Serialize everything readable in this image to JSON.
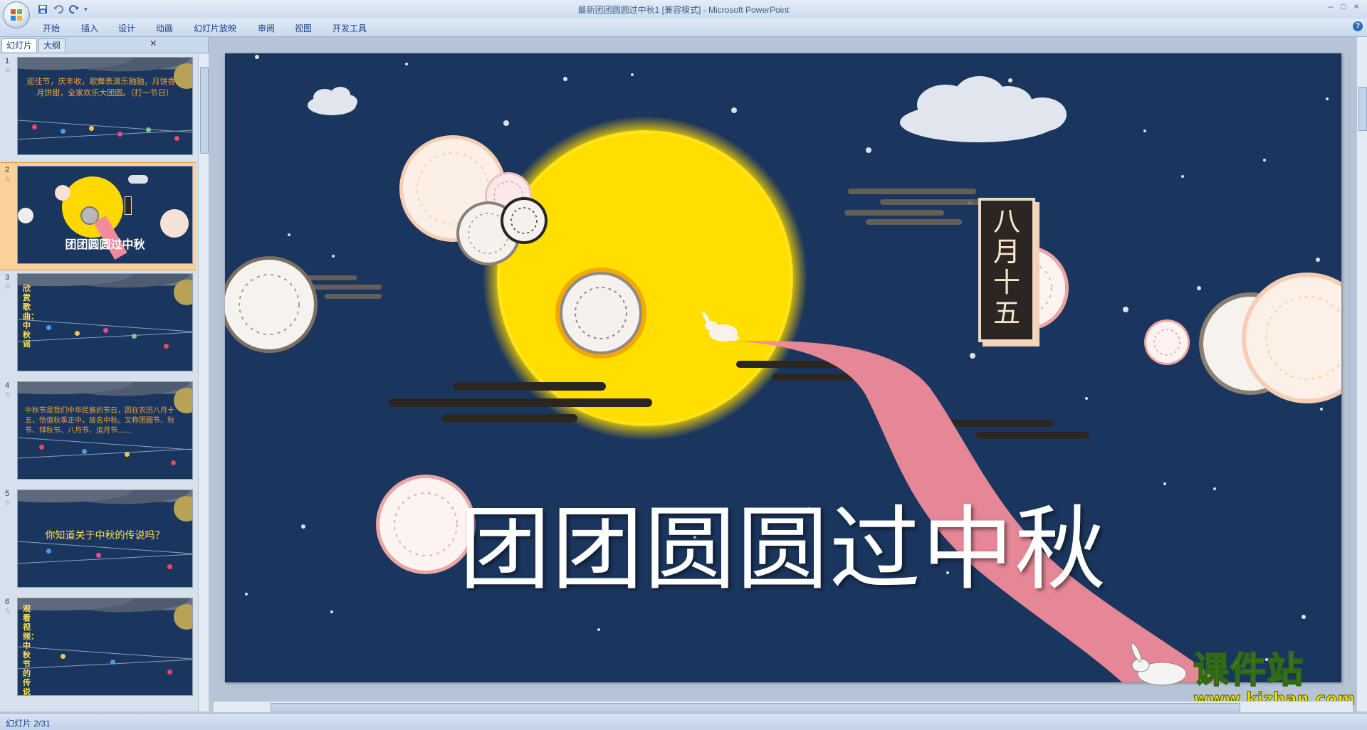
{
  "window": {
    "title": "最新团团圆圆过中秋1 [兼容模式] - Microsoft PowerPoint",
    "controls": [
      "–",
      "□",
      "×"
    ]
  },
  "ribbon": {
    "tabs": [
      "开始",
      "插入",
      "设计",
      "动画",
      "幻灯片放映",
      "审阅",
      "视图",
      "开发工具"
    ],
    "help": "?"
  },
  "panel": {
    "tabs": [
      "幻灯片",
      "大纲"
    ],
    "close": "×"
  },
  "thumbnails": [
    {
      "num": "1",
      "text": "迎佳节，庆丰收，歌舞表演乐融融，月饼香，月饼甜，全家欢乐大团圆。（打一节日）"
    },
    {
      "num": "2",
      "text": "团团圆圆过中秋"
    },
    {
      "num": "3",
      "text": "欣赏歌曲：中秋谣"
    },
    {
      "num": "4",
      "text": "中秋节是我们中华民族的节日，因在农历八月十五，恰值秋季正中，故名中秋。又称团圆节、秋节、拜秋节、八月节、追月节……"
    },
    {
      "num": "5",
      "text": "你知道关于中秋的传说吗？"
    },
    {
      "num": "6",
      "text": "观看视频：中秋节的传说"
    }
  ],
  "slide": {
    "title": "团团圆圆过中秋",
    "badge": "八月十五",
    "colors": {
      "background": "#1b365e",
      "moon": "#ffd800",
      "ribbon": "#f08c9a"
    }
  },
  "watermark": {
    "name": "课件站",
    "url": "www.kjzhan.com"
  },
  "status": {
    "text": "幻灯片 2/31"
  }
}
